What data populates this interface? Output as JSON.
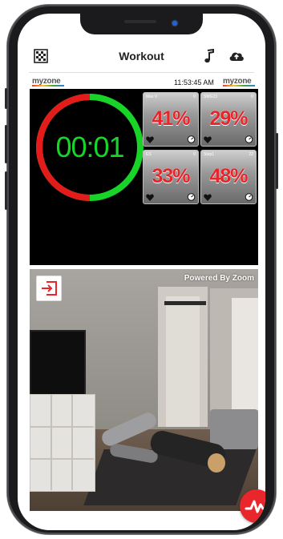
{
  "header": {
    "title": "Workout",
    "left_icon": "grid-icon",
    "music_icon": "music-note-icon",
    "upload_icon": "cloud-upload-icon"
  },
  "dashboard": {
    "logo_left": "myzone",
    "logo_right": "myzone",
    "clock": "11:53:45 AM",
    "timer": "00:01",
    "timer_colors": {
      "elapsed": "#e31b1b",
      "remaining": "#18d428"
    },
    "tiles": [
      {
        "name": "Max V",
        "count": "0",
        "percent": "41%"
      },
      {
        "name": "SMG23",
        "count": "0",
        "percent": "29%"
      },
      {
        "name": "ES",
        "count": "0",
        "percent": "33%"
      },
      {
        "name": "Step1",
        "count": "22",
        "percent": "48%"
      }
    ],
    "percent_color": "#e4252a"
  },
  "video": {
    "overlay_text": "Powered By Zoom",
    "exit_icon": "exit-icon",
    "zone_icon": "heartbeat-icon"
  },
  "colors": {
    "accent": "#e8262c",
    "dashboard_bg": "#000000"
  }
}
